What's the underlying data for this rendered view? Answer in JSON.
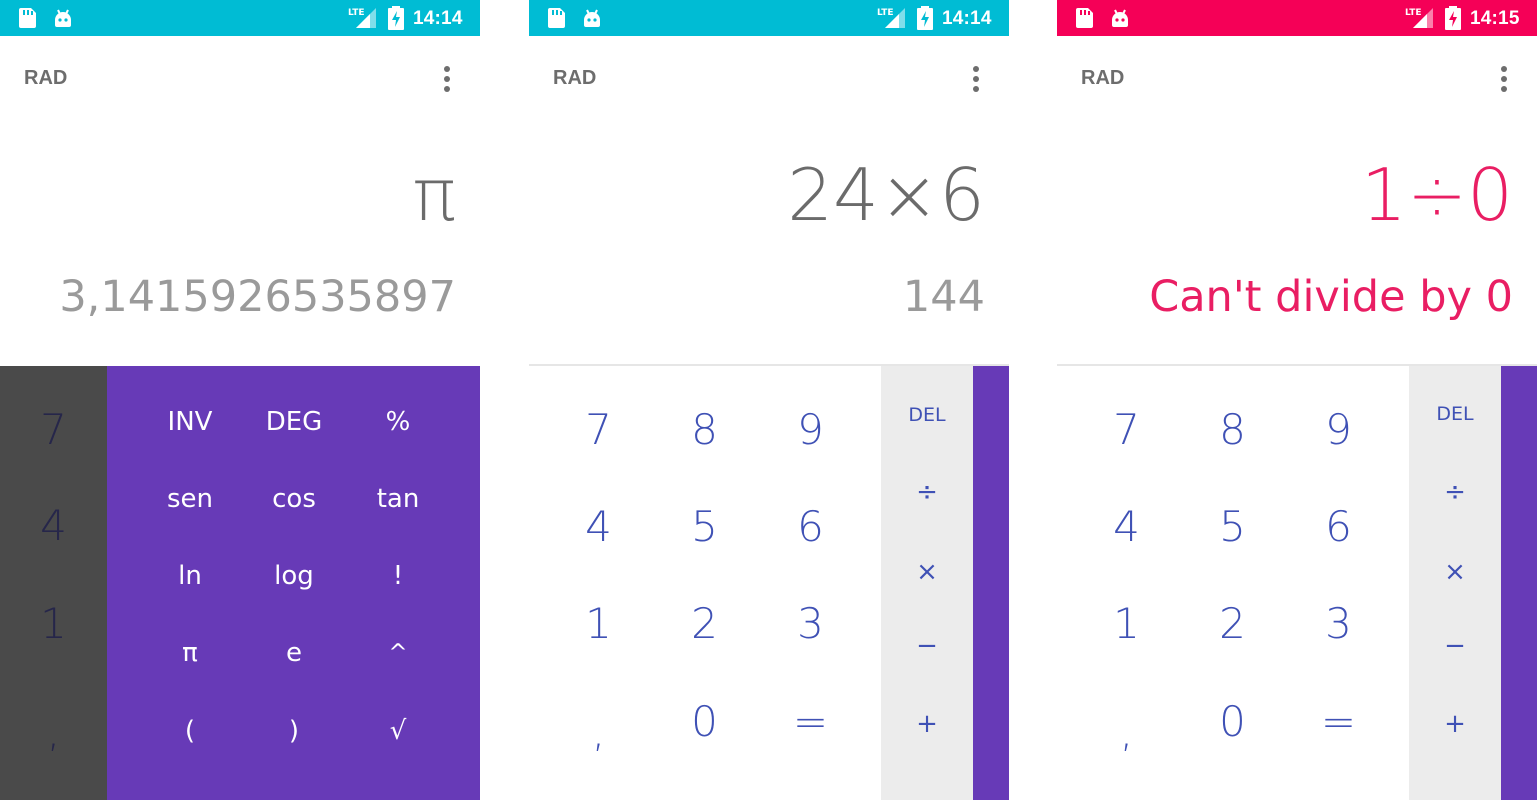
{
  "screens": [
    {
      "status_bar": {
        "time": "14:14",
        "color": "#00bcd4",
        "icons": [
          "sd-card-icon",
          "android-icon",
          "lte-signal-icon",
          "battery-charging-icon"
        ]
      },
      "mode": "RAD",
      "formula": "π",
      "result": "3,1415926535897",
      "advanced_panel_open": true,
      "dimmed_keys": [
        "7",
        "4",
        "1",
        ","
      ],
      "advanced_keys": [
        [
          "INV",
          "DEG",
          "%"
        ],
        [
          "sen",
          "cos",
          "tan"
        ],
        [
          "ln",
          "log",
          "!"
        ],
        [
          "π",
          "e",
          "^"
        ],
        [
          "(",
          ")",
          "√"
        ]
      ]
    },
    {
      "status_bar": {
        "time": "14:14",
        "color": "#00bcd4",
        "icons": [
          "sd-card-icon",
          "android-icon",
          "lte-signal-icon",
          "battery-charging-icon"
        ]
      },
      "mode": "RAD",
      "formula": "24×6",
      "result": "144",
      "advanced_panel_open": false,
      "digit_keys": [
        [
          "7",
          "8",
          "9"
        ],
        [
          "4",
          "5",
          "6"
        ],
        [
          "1",
          "2",
          "3"
        ],
        [
          ",",
          "0",
          "="
        ]
      ],
      "operator_keys": [
        "DEL",
        "÷",
        "×",
        "−",
        "+"
      ]
    },
    {
      "status_bar": {
        "time": "14:15",
        "color": "#f50057",
        "icons": [
          "sd-card-icon",
          "android-icon",
          "lte-signal-icon",
          "battery-charging-icon"
        ]
      },
      "mode": "RAD",
      "formula": "1÷0",
      "result": "Can't divide by 0",
      "result_state": "error",
      "advanced_panel_open": false,
      "digit_keys": [
        [
          "7",
          "8",
          "9"
        ],
        [
          "4",
          "5",
          "6"
        ],
        [
          "1",
          "2",
          "3"
        ],
        [
          ",",
          "0",
          "="
        ]
      ],
      "operator_keys": [
        "DEL",
        "÷",
        "×",
        "−",
        "+"
      ]
    }
  ],
  "colors": {
    "accent": "#3f51b5",
    "advanced_panel": "#673ab7",
    "operator_pad": "#ececec",
    "error": "#e91e63",
    "formula_text": "#6b6b6b",
    "result_text": "#9a9a9a"
  }
}
